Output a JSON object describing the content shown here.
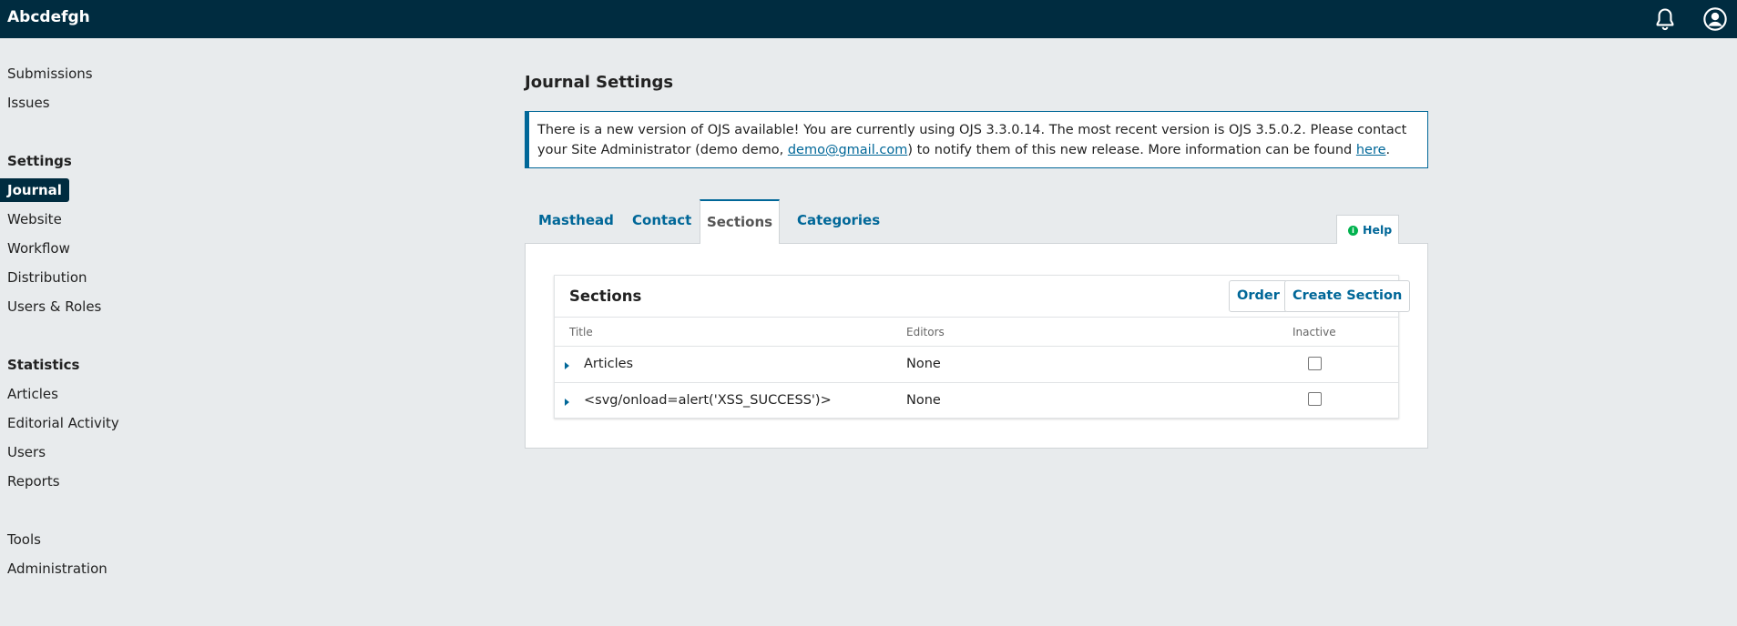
{
  "header": {
    "site_title": "Abcdefgh",
    "bell_icon": "bell-icon",
    "user_icon": "user-icon"
  },
  "nav": {
    "submissions": "Submissions",
    "issues": "Issues",
    "settings_head": "Settings",
    "journal": "Journal",
    "website": "Website",
    "workflow": "Workflow",
    "distribution": "Distribution",
    "users_roles": "Users & Roles",
    "statistics_head": "Statistics",
    "articles": "Articles",
    "editorial_activity": "Editorial Activity",
    "users": "Users",
    "reports": "Reports",
    "tools": "Tools",
    "administration": "Administration"
  },
  "page": {
    "title": "Journal Settings"
  },
  "notice": {
    "text1": "There is a new version of OJS available! You are currently using OJS 3.3.0.14. The most recent version is OJS 3.5.0.2. Please contact your Site Administrator (demo demo, ",
    "email": "demo@gmail.com",
    "text2": ") to notify them of this new release. More information can be found ",
    "link": "here",
    "text3": "."
  },
  "tabs": {
    "masthead": "Masthead",
    "contact": "Contact",
    "sections": "Sections",
    "categories": "Categories",
    "help": "Help"
  },
  "grid": {
    "title": "Sections",
    "order_label": "Order",
    "create_label": "Create Section",
    "col_title": "Title",
    "col_editors": "Editors",
    "col_inactive": "Inactive",
    "rows": [
      {
        "title": "Articles",
        "editors": "None",
        "inactive": false
      },
      {
        "title": "<svg/onload=alert('XSS_SUCCESS')>",
        "editors": "None",
        "inactive": false
      }
    ]
  }
}
